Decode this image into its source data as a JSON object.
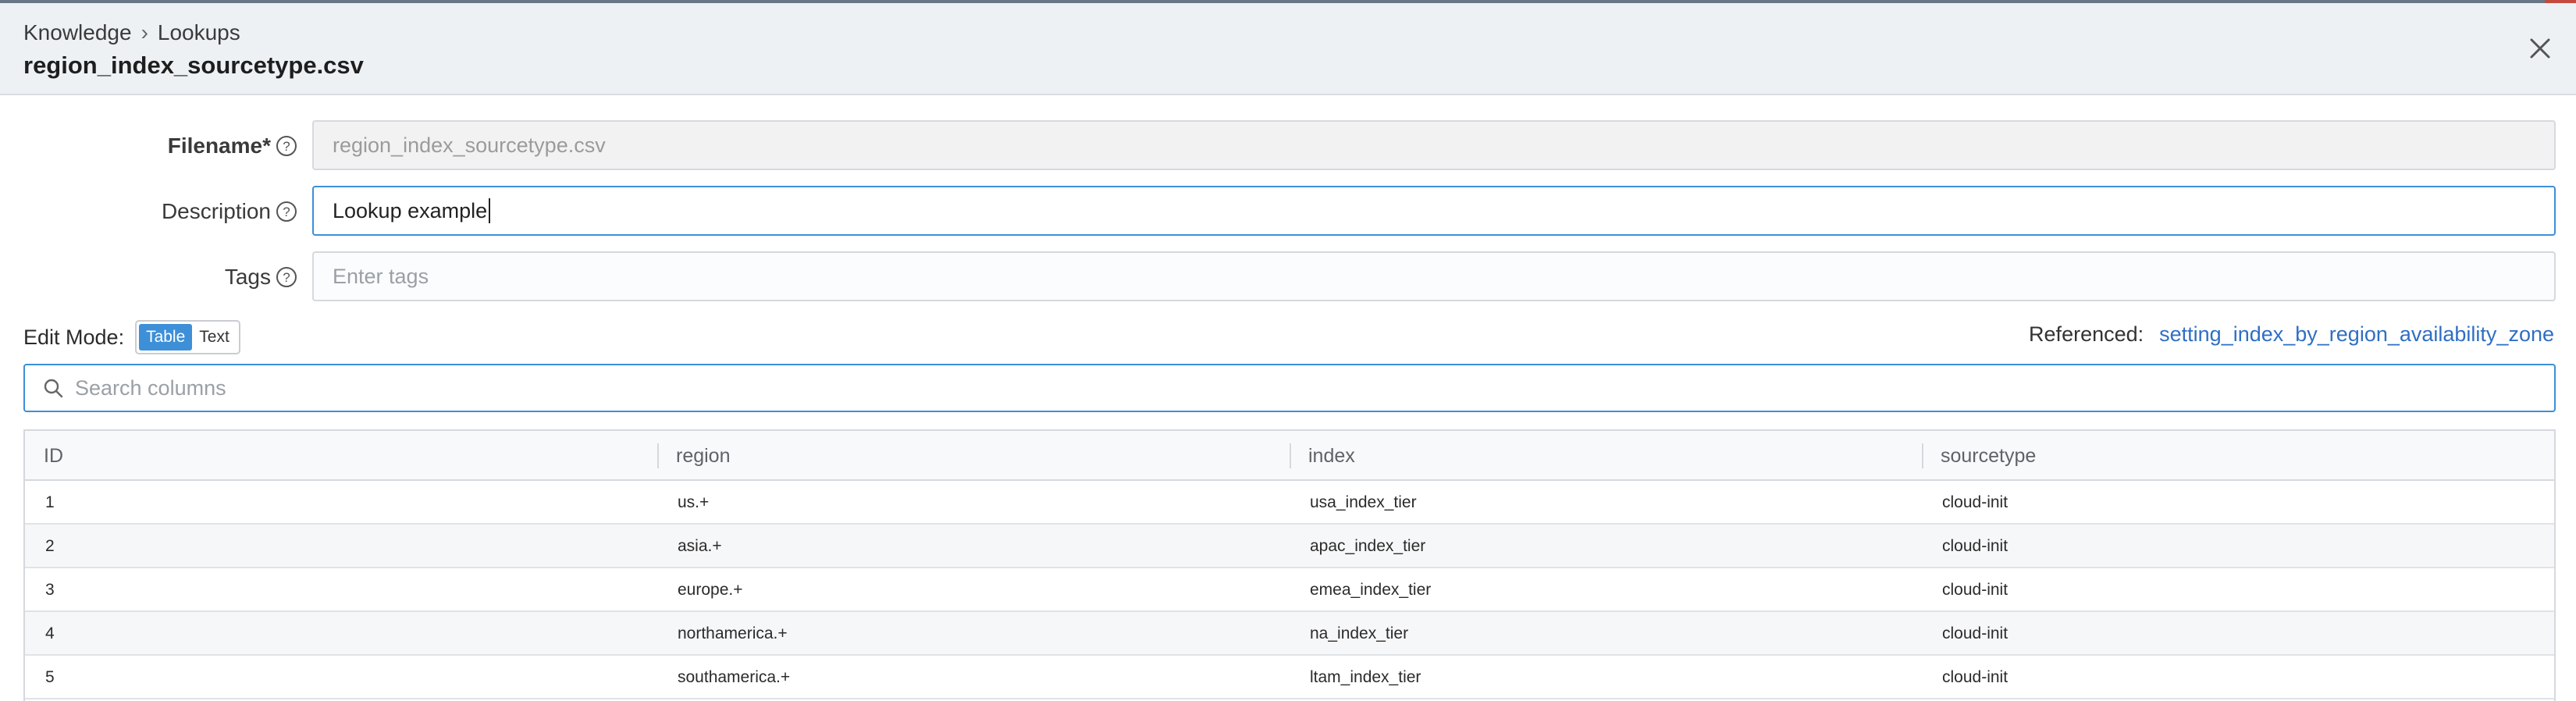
{
  "header": {
    "breadcrumb": [
      "Knowledge",
      "Lookups"
    ],
    "breadcrumb_separator": "›",
    "title": "region_index_sourcetype.csv"
  },
  "form": {
    "filename": {
      "label": "Filename*",
      "value": "region_index_sourcetype.csv"
    },
    "description": {
      "label": "Description",
      "value": "Lookup example"
    },
    "tags": {
      "label": "Tags",
      "placeholder": "Enter tags"
    }
  },
  "edit_mode": {
    "label": "Edit Mode:",
    "options": [
      "Table",
      "Text"
    ],
    "selected": "Table"
  },
  "referenced": {
    "label": "Referenced:",
    "link": "setting_index_by_region_availability_zone"
  },
  "search": {
    "placeholder": "Search columns"
  },
  "table": {
    "columns": [
      "ID",
      "region",
      "index",
      "sourcetype"
    ],
    "rows": [
      [
        "1",
        "us.+",
        "usa_index_tier",
        "cloud-init"
      ],
      [
        "2",
        "asia.+",
        "apac_index_tier",
        "cloud-init"
      ],
      [
        "3",
        "europe.+",
        "emea_index_tier",
        "cloud-init"
      ],
      [
        "4",
        "northamerica.+",
        "na_index_tier",
        "cloud-init"
      ],
      [
        "5",
        "southamerica.+",
        "ltam_index_tier",
        "cloud-init"
      ]
    ]
  },
  "colors": {
    "accent": "#3d8fd8",
    "link": "#2f6fc2",
    "header_bg": "#eef1f4"
  },
  "icons": {
    "close": "close-icon",
    "help": "help-circle-icon",
    "search": "search-icon"
  }
}
